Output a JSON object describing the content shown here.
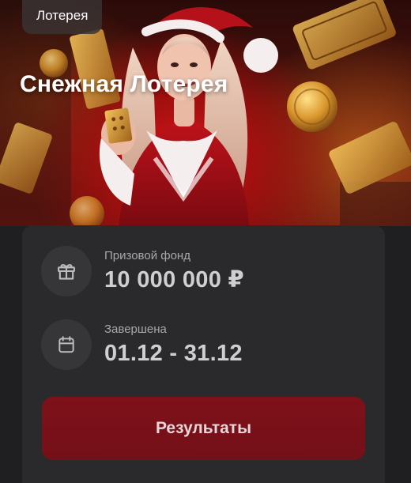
{
  "hero": {
    "tag": "Лотерея",
    "title": "Снежная Лотерея"
  },
  "prize": {
    "icon": "gift-icon",
    "label": "Призовой фонд",
    "value": "10 000 000 ₽"
  },
  "dates": {
    "icon": "calendar-icon",
    "label": "Завершена",
    "value": "01.12 - 31.12"
  },
  "actions": {
    "results_label": "Результаты"
  },
  "colors": {
    "background": "#1f1f21",
    "card": "#2a2a2c",
    "icon_circle": "#363638",
    "button": "#7e1119",
    "button_text": "#e6d7d8",
    "label_text": "#a8a8aa",
    "value_text": "#cfcfd1"
  }
}
